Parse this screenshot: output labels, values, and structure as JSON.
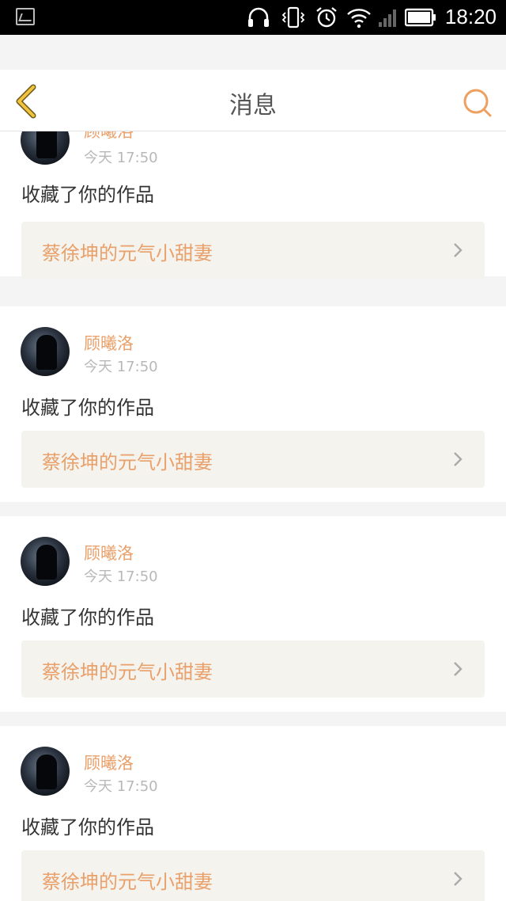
{
  "status_bar": {
    "time": "18:20",
    "icons": [
      "gallery-icon",
      "headset-icon",
      "vibrate-icon",
      "alarm-icon",
      "wifi-icon",
      "signal-icon",
      "battery-icon"
    ]
  },
  "header": {
    "title": "消息",
    "back_icon": "chevron-left-icon",
    "search_icon": "search-icon"
  },
  "colors": {
    "accent": "#e9a06a",
    "back_arrow": "#f3c33c",
    "card_bg": "#ffffff",
    "work_bg": "#f4f3ee"
  },
  "messages": [
    {
      "user": "顾曦洛",
      "time": "今天 17:50",
      "action": "收藏了你的作品",
      "work_title": "蔡徐坤的元气小甜妻"
    },
    {
      "user": "顾曦洛",
      "time": "今天 17:50",
      "action": "收藏了你的作品",
      "work_title": "蔡徐坤的元气小甜妻"
    },
    {
      "user": "顾曦洛",
      "time": "今天 17:50",
      "action": "收藏了你的作品",
      "work_title": "蔡徐坤的元气小甜妻"
    },
    {
      "user": "顾曦洛",
      "time": "今天 17:50",
      "action": "收藏了你的作品",
      "work_title": "蔡徐坤的元气小甜妻"
    }
  ]
}
